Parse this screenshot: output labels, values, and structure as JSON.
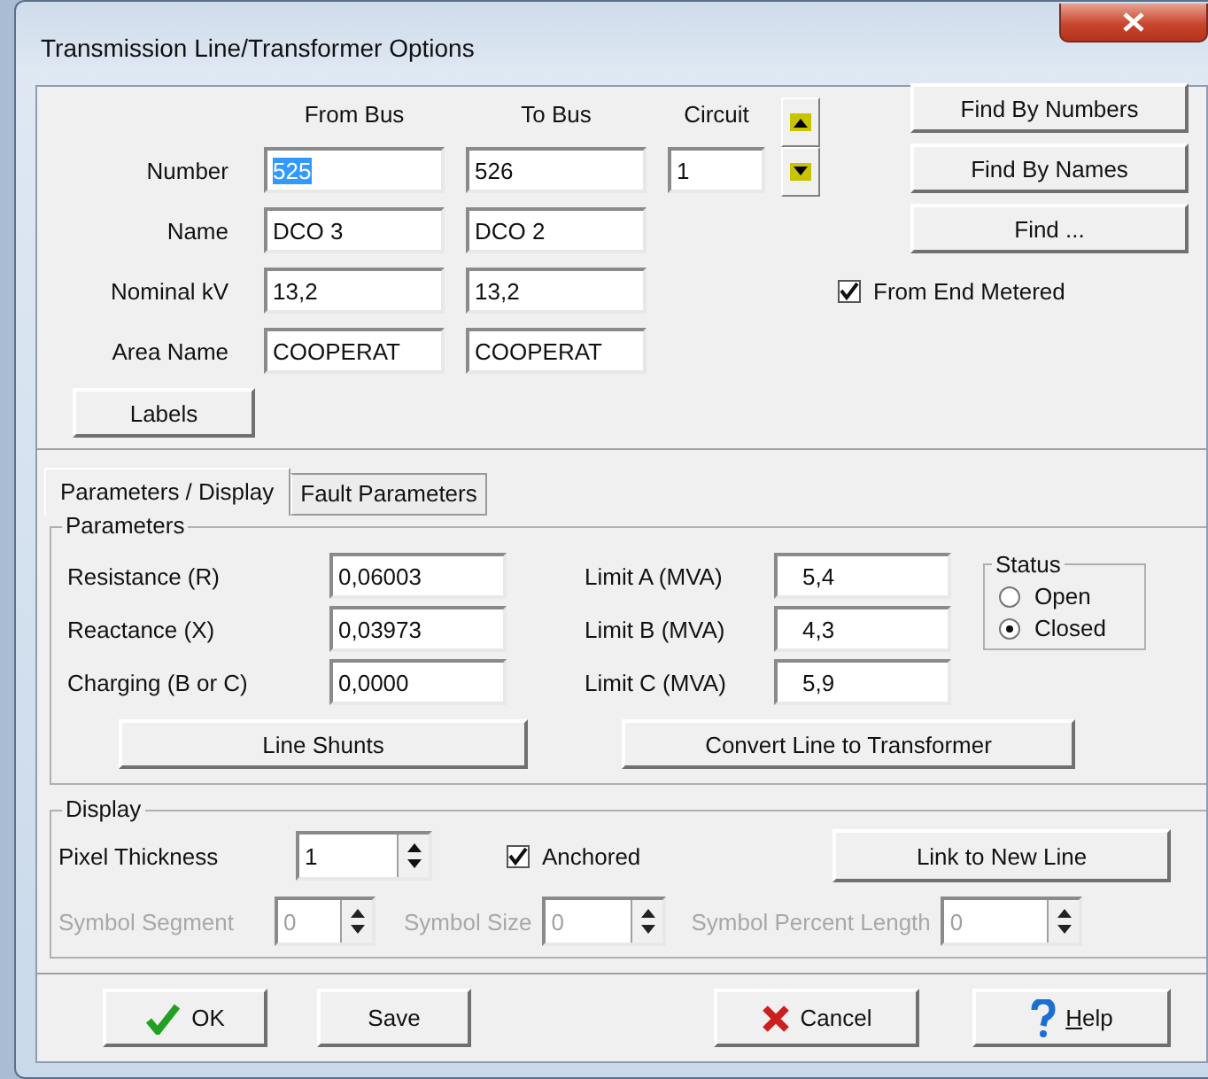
{
  "window": {
    "title": "Transmission Line/Transformer Options"
  },
  "bus": {
    "columns": [
      "From Bus",
      "To Bus",
      "Circuit"
    ],
    "rows": [
      {
        "label": "Number",
        "from": "525",
        "to": "526",
        "circuit": "1",
        "from_highlighted": true
      },
      {
        "label": "Name",
        "from": "DCO 3",
        "to": "DCO 2",
        "from_highlighted": false
      },
      {
        "label": "Nominal kV",
        "from": "13,2",
        "to": "13,2",
        "from_highlighted": false
      },
      {
        "label": "Area Name",
        "from": "COOPERAT",
        "to": "COOPERAT",
        "from_highlighted": false
      }
    ]
  },
  "find_buttons": [
    "Find By Numbers",
    "Find By Names",
    "Find ..."
  ],
  "from_end_metered": {
    "label": "From End Metered",
    "checked": true
  },
  "labels_button": "Labels",
  "tabs": [
    {
      "label": "Parameters / Display",
      "selected": true
    },
    {
      "label": "Fault Parameters",
      "selected": false
    }
  ],
  "parameters": {
    "title": "Parameters",
    "fields": [
      {
        "label": "Resistance (R)",
        "value": "0,06003"
      },
      {
        "label": "Reactance (X)",
        "value": "0,03973"
      },
      {
        "label": "Charging (B or C)",
        "value": "0,0000"
      }
    ],
    "limits": [
      {
        "label": "Limit A (MVA)",
        "value": "5,4"
      },
      {
        "label": "Limit B (MVA)",
        "value": "4,3"
      },
      {
        "label": "Limit C (MVA)",
        "value": "5,9"
      }
    ],
    "status": {
      "title": "Status",
      "options": [
        {
          "label": "Open",
          "selected": false
        },
        {
          "label": "Closed",
          "selected": true
        }
      ]
    },
    "buttons": [
      "Line Shunts",
      "Convert Line to Transformer"
    ]
  },
  "display": {
    "title": "Display",
    "pixel_thickness": {
      "label": "Pixel Thickness",
      "value": "1"
    },
    "anchored": {
      "label": "Anchored",
      "checked": true
    },
    "link_button": "Link to New Line",
    "symbols": [
      {
        "label": "Symbol Segment",
        "value": "0",
        "disabled": true
      },
      {
        "label": "Symbol Size",
        "value": "0",
        "disabled": true
      },
      {
        "label": "Symbol Percent Length",
        "value": "0",
        "disabled": true
      }
    ]
  },
  "footer_buttons": [
    {
      "label": "OK",
      "kind": "ok",
      "accelerator_underlined": false
    },
    {
      "label": "Save",
      "kind": "plain",
      "accelerator_underlined": false
    },
    {
      "label": "Cancel",
      "kind": "cancel",
      "accelerator_underlined": false
    },
    {
      "label": "Help",
      "kind": "help",
      "accelerator_underlined": true
    }
  ]
}
